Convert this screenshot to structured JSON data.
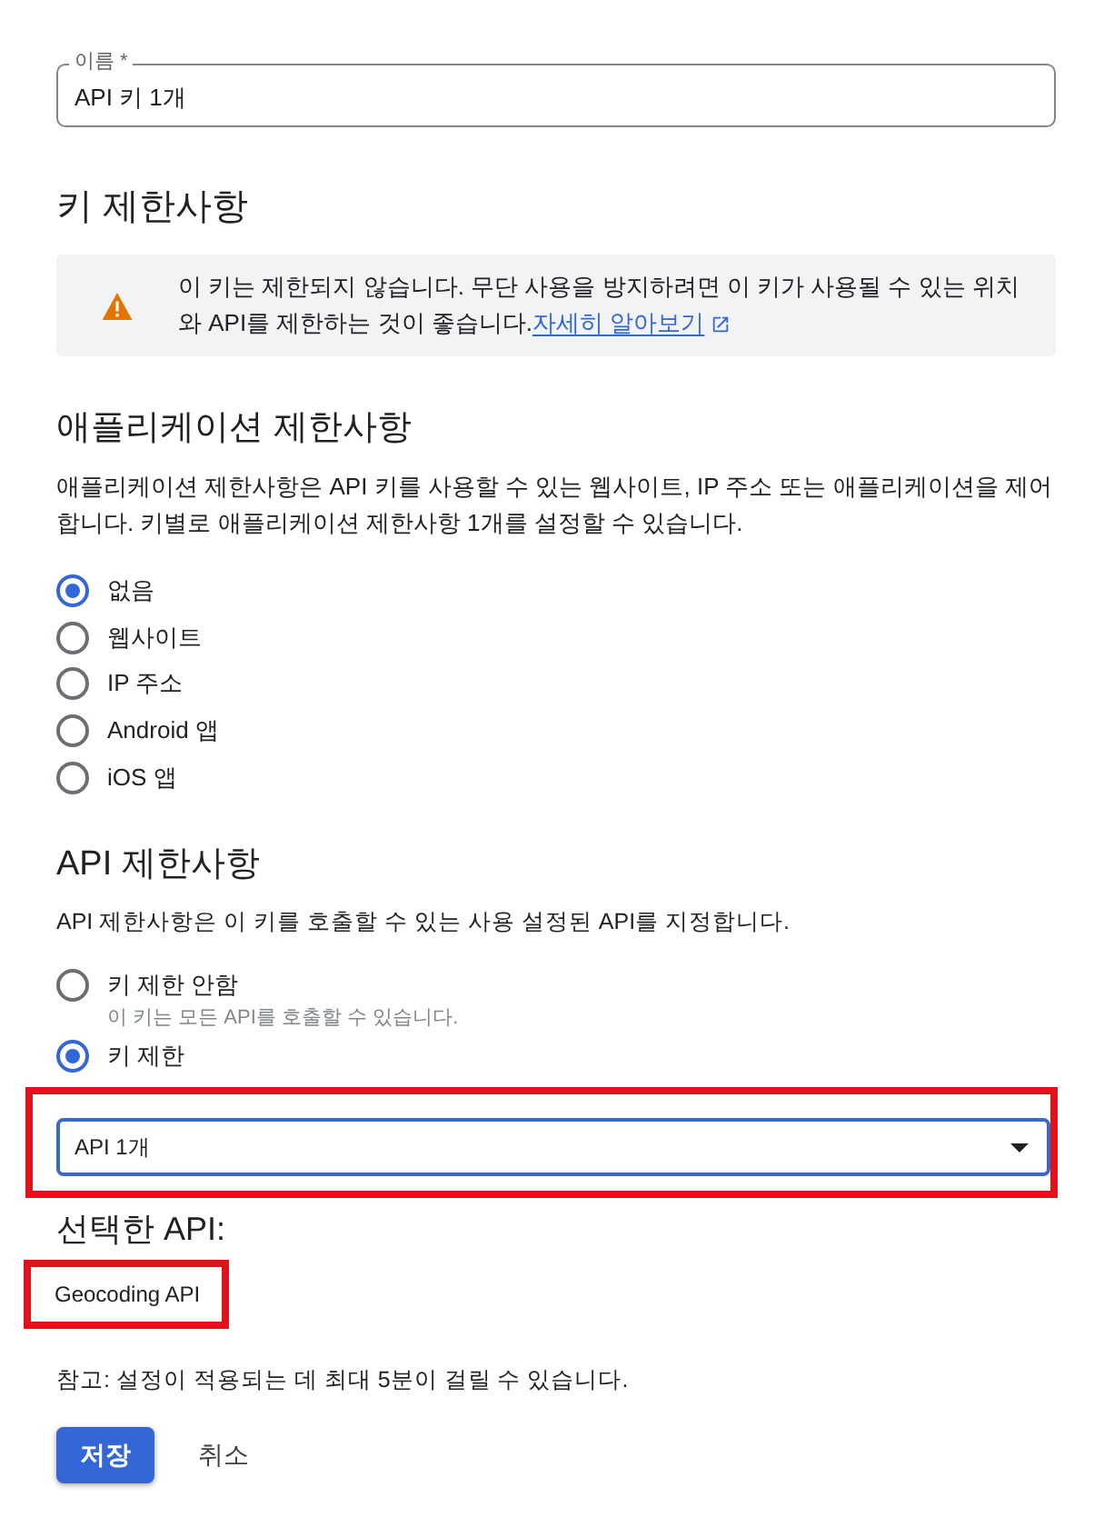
{
  "name_field": {
    "label": "이름 *",
    "value": "API 키 1개"
  },
  "key_restrictions": {
    "heading": "키 제한사항",
    "warning": {
      "text": "이 키는 제한되지 않습니다. 무단 사용을 방지하려면 이 키가 사용될 수 있는 위치와 API를 제한하는 것이 좋습니다.",
      "link": "자세히 알아보기"
    }
  },
  "application_restrictions": {
    "heading": "애플리케이션 제한사항",
    "description": "애플리케이션 제한사항은 API 키를 사용할 수 있는 웹사이트, IP 주소 또는 애플리케이션을 제어합니다. 키별로 애플리케이션 제한사항 1개를 설정할 수 있습니다.",
    "options": [
      {
        "label": "없음",
        "selected": true
      },
      {
        "label": "웹사이트",
        "selected": false
      },
      {
        "label": "IP 주소",
        "selected": false
      },
      {
        "label": "Android 앱",
        "selected": false
      },
      {
        "label": "iOS 앱",
        "selected": false
      }
    ]
  },
  "api_restrictions": {
    "heading": "API 제한사항",
    "description": "API 제한사항은 이 키를 호출할 수 있는 사용 설정된 API를 지정합니다.",
    "options": [
      {
        "label": "키 제한 안함",
        "hint": "이 키는 모든 API를 호출할 수 있습니다.",
        "selected": false
      },
      {
        "label": "키 제한",
        "selected": true
      }
    ],
    "dropdown": {
      "value": "API 1개",
      "highlighted": true
    },
    "selected_heading": "선택한 API:",
    "selected_apis": [
      {
        "name": "Geocoding API",
        "highlighted": true
      }
    ]
  },
  "note": "참고: 설정이 적용되는 데 최대 5분이 걸릴 수 있습니다.",
  "buttons": [
    {
      "label": "저장",
      "kind": "primary"
    },
    {
      "label": "취소",
      "kind": "text"
    }
  ]
}
